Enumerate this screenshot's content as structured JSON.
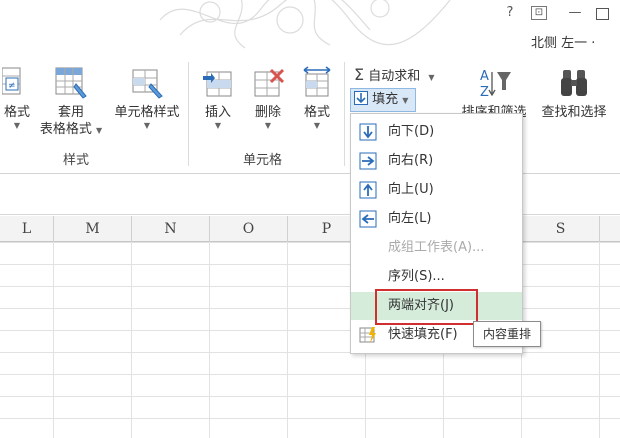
{
  "window": {
    "help": "?",
    "restore": "⊡",
    "minimize": "—",
    "maximize": "☐"
  },
  "user": "北侧 左一 ·",
  "ribbon": {
    "cond_format_label": "格式",
    "table_format_label_1": "套用",
    "table_format_label_2": "表格格式",
    "cell_style_label": "单元格样式",
    "styles_group": "样式",
    "insert_label": "插入",
    "delete_label": "删除",
    "format_label": "格式",
    "cells_group": "单元格",
    "autosum_label": "自动求和",
    "fill_label": "填充",
    "sort_filter_label": "排序和筛选",
    "find_select_label": "查找和选择"
  },
  "columns": [
    "L",
    "M",
    "N",
    "O",
    "P",
    "S"
  ],
  "fill_menu": {
    "items": [
      {
        "label": "向下(D)",
        "icon": "arrow-down-icon",
        "enabled": true
      },
      {
        "label": "向右(R)",
        "icon": "arrow-right-icon",
        "enabled": true
      },
      {
        "label": "向上(U)",
        "icon": "arrow-up-icon",
        "enabled": true
      },
      {
        "label": "向左(L)",
        "icon": "arrow-left-icon",
        "enabled": true
      },
      {
        "label": "成组工作表(A)...",
        "icon": "",
        "enabled": false
      },
      {
        "label": "序列(S)...",
        "icon": "",
        "enabled": true
      },
      {
        "label": "两端对齐(J)",
        "icon": "",
        "enabled": true,
        "highlighted": true
      },
      {
        "label": "快速填充(F)",
        "icon": "flash-fill-icon",
        "enabled": true
      }
    ],
    "tooltip": "内容重排"
  },
  "colors": {
    "menu_highlight": "#d5ecda",
    "annotation_red": "#d02f2f",
    "accent_blue": "#2b6cb8"
  }
}
